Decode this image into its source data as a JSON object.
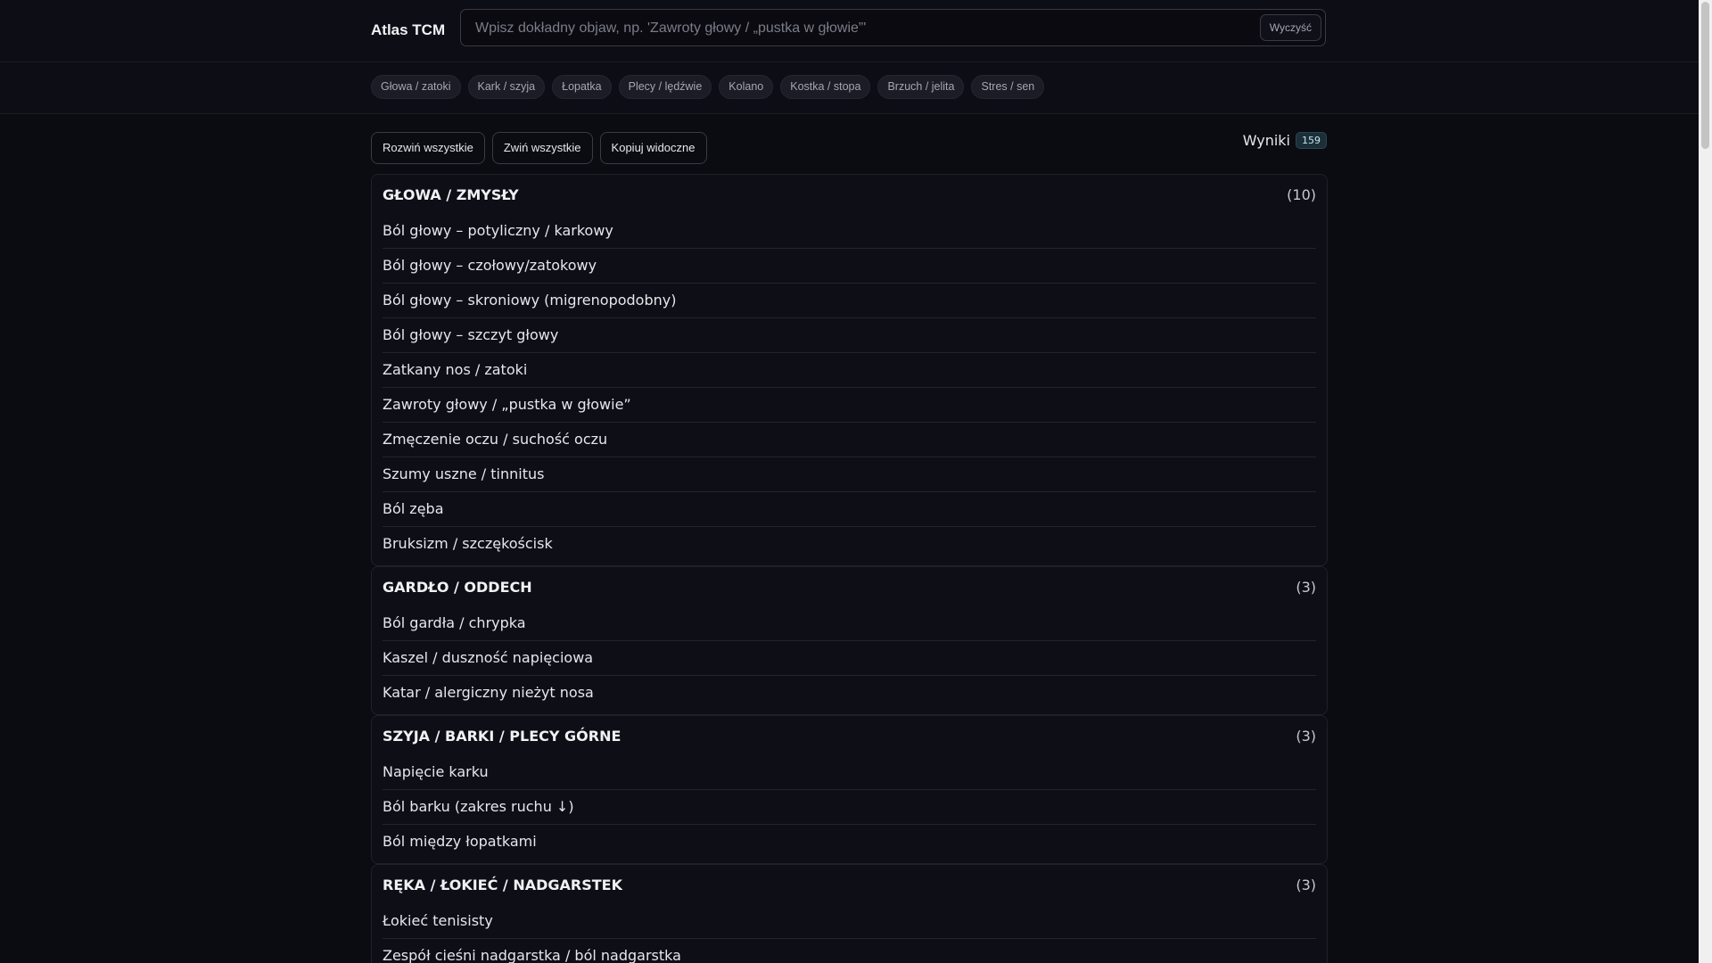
{
  "app": {
    "title": "Atlas TCM"
  },
  "search": {
    "placeholder": "Wpisz dokładny objaw, np. 'Zawroty głowy / „pustka w głowie”'",
    "value": "",
    "clear_label": "Wyczyść"
  },
  "chips": [
    "Głowa / zatoki",
    "Kark / szyja",
    "Łopatka",
    "Plecy / lędźwie",
    "Kolano",
    "Kostka / stopa",
    "Brzuch / jelita",
    "Stres / sen"
  ],
  "toolbar": {
    "expand_all": "Rozwiń wszystkie",
    "collapse_all": "Zwiń wszystkie",
    "copy_visible": "Kopiuj widoczne"
  },
  "results": {
    "label": "Wyniki",
    "count": "159"
  },
  "groups": [
    {
      "title": "GŁOWA / ZMYSŁY",
      "count": "(10)",
      "items": [
        "Ból głowy – potyliczny / karkowy",
        "Ból głowy – czołowy/zatokowy",
        "Ból głowy – skroniowy (migrenopodobny)",
        "Ból głowy – szczyt głowy",
        "Zatkany nos / zatoki",
        "Zawroty głowy / „pustka w głowie”",
        "Zmęczenie oczu / suchość oczu",
        "Szumy uszne / tinnitus",
        "Ból zęba",
        "Bruksizm / szczękościsk"
      ]
    },
    {
      "title": "GARDŁO / ODDECH",
      "count": "(3)",
      "items": [
        "Ból gardła / chrypka",
        "Kaszel / duszność napięciowa",
        "Katar / alergiczny nieżyt nosa"
      ]
    },
    {
      "title": "SZYJA / BARKI / PLECY GÓRNE",
      "count": "(3)",
      "items": [
        "Napięcie karku",
        "Ból barku (zakres ruchu ↓)",
        "Ból między łopatkami"
      ]
    },
    {
      "title": "RĘKA / ŁOKIEĆ / NADGARSTEK",
      "count": "(3)",
      "items": [
        "Łokieć tenisisty",
        "Zespół cieśni nadgarstka / ból nadgarstka"
      ]
    }
  ]
}
